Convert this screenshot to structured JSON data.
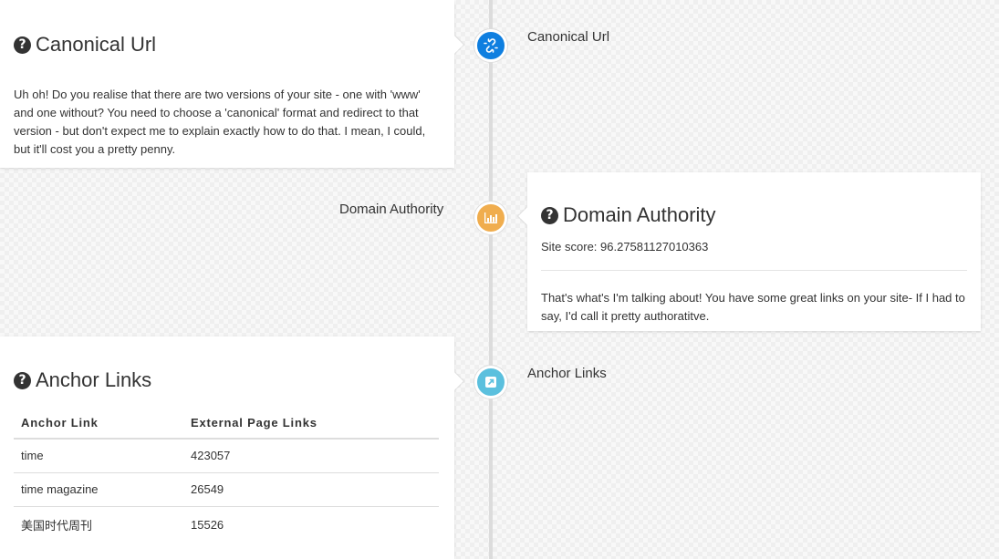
{
  "colors": {
    "canonical_badge": "#0f7fe0",
    "authority_badge": "#f0ad4e",
    "anchor_badge": "#5bc0de"
  },
  "canonical": {
    "timeline_label": "Canonical Url",
    "title": "Canonical Url",
    "title_icon": "question-circle-icon",
    "badge_icon": "unlink-icon",
    "body": "Uh oh! Do you realise that there are two versions of your site - one with 'www' and one without? You need to choose a 'canonical' format and redirect to that version - but don't expect me to explain exactly how to do that. I mean, I could, but it'll cost you a pretty penny."
  },
  "authority": {
    "timeline_label": "Domain Authority",
    "title": "Domain Authority",
    "title_icon": "question-circle-icon",
    "badge_icon": "bar-chart-icon",
    "score": "Site score: 96.27581127010363",
    "body": "That's what's I'm talking about! You have some great links on your site- If I had to say, I'd call it pretty authoratitve."
  },
  "anchors": {
    "timeline_label": "Anchor Links",
    "title": "Anchor Links",
    "title_icon": "question-circle-icon",
    "badge_icon": "external-link-icon",
    "columns": [
      "Anchor Link",
      "External Page Links"
    ],
    "rows": [
      [
        "time",
        "423057"
      ],
      [
        "time magazine",
        "26549"
      ],
      [
        "美国时代周刊",
        "15526"
      ]
    ]
  }
}
